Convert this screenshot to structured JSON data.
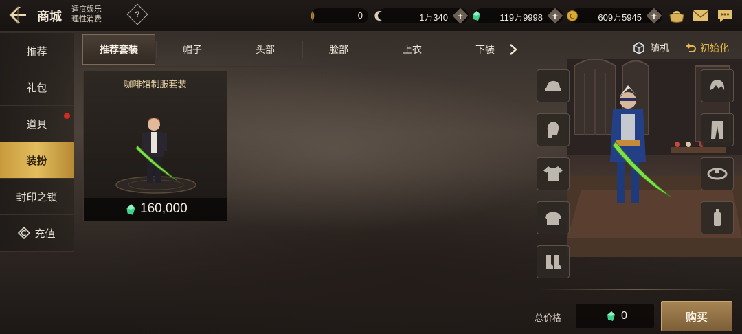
{
  "header": {
    "title": "商城",
    "notice_line1": "适度娱乐",
    "notice_line2": "理性消费",
    "help_label": "?"
  },
  "currencies": [
    {
      "name": "feather",
      "icon": "feather-icon",
      "amount": "0"
    },
    {
      "name": "moon-coin",
      "icon": "crescent-coin-icon",
      "amount": "1万340"
    },
    {
      "name": "gem",
      "icon": "green-gem-icon",
      "amount": "119万9998"
    },
    {
      "name": "gold",
      "icon": "gold-coin-icon",
      "amount": "609万5945"
    }
  ],
  "plus_label": "+",
  "sidebar": {
    "items": [
      {
        "label": "推荐",
        "active": false,
        "badge": false
      },
      {
        "label": "礼包",
        "active": false,
        "badge": false
      },
      {
        "label": "道具",
        "active": false,
        "badge": true
      },
      {
        "label": "装扮",
        "active": true,
        "badge": false
      },
      {
        "label": "封印之锁",
        "active": false,
        "badge": false
      },
      {
        "label": "充值",
        "active": false,
        "badge": false,
        "icon": "recharge-icon"
      }
    ]
  },
  "tabs": [
    {
      "label": "推荐套装",
      "active": true
    },
    {
      "label": "帽子",
      "active": false
    },
    {
      "label": "头部",
      "active": false
    },
    {
      "label": "脸部",
      "active": false
    },
    {
      "label": "上衣",
      "active": false
    },
    {
      "label": "下装",
      "active": false
    }
  ],
  "product": {
    "name": "咖啡馆制服套装",
    "price": "160,000"
  },
  "preview": {
    "random_label": "随机",
    "reset_label": "初始化",
    "left_slots": [
      "hat-slot-icon",
      "head-slot-icon",
      "top-slot-icon",
      "shoulder-slot-icon",
      "shoes-slot-icon"
    ],
    "right_slots": [
      "hair-slot-icon",
      "pants-slot-icon",
      "belt-slot-icon",
      "weapon-slot-icon"
    ]
  },
  "footer": {
    "total_label": "总价格",
    "total_value": "0",
    "buy_label": "购买"
  },
  "colors": {
    "accent_gold": "#e2bd5e",
    "gem_green": "#3fd08a",
    "badge_red": "#d22b1f"
  }
}
